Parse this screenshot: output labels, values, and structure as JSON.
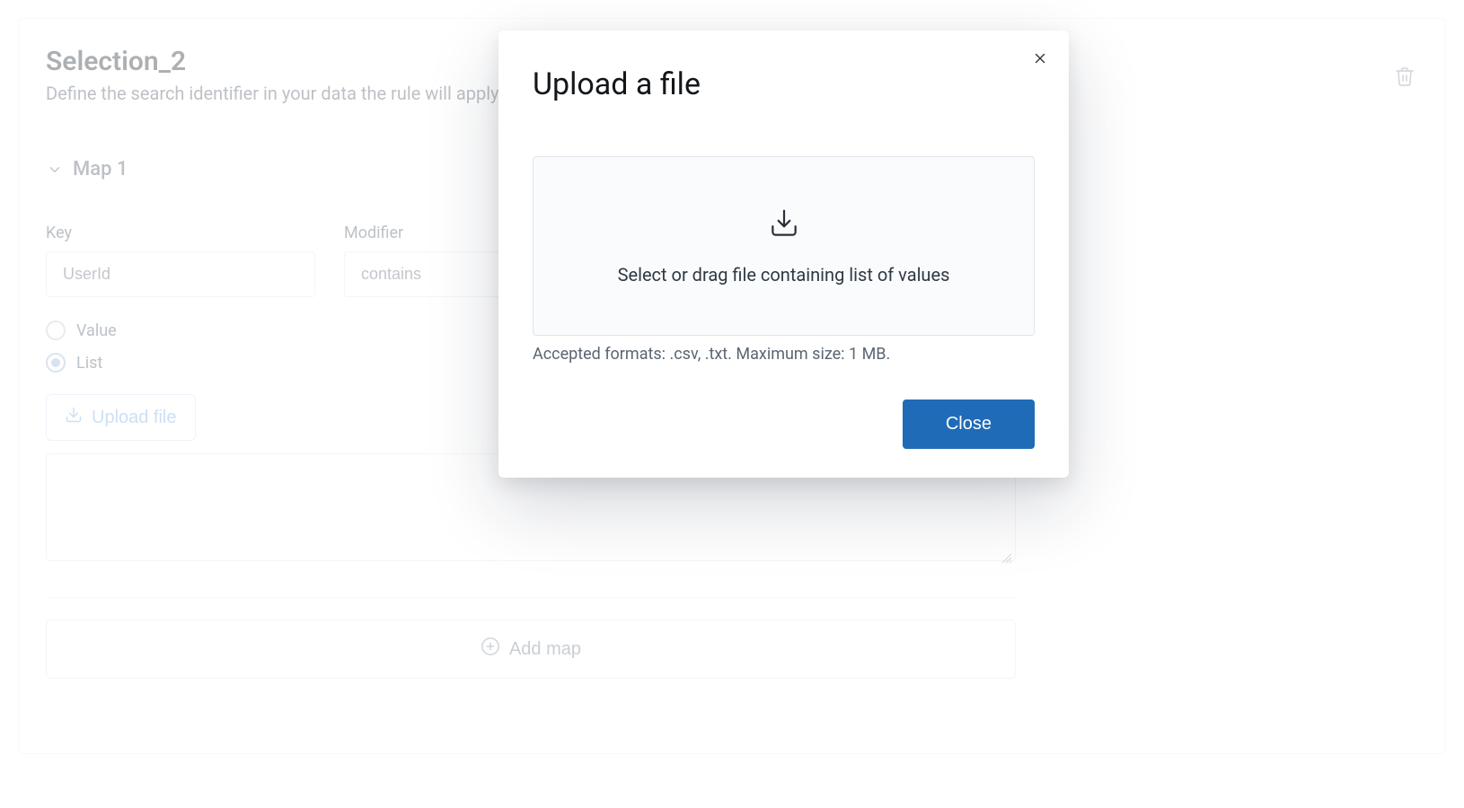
{
  "panel": {
    "title": "Selection_2",
    "subtitle": "Define the search identifier in your data the rule will apply to."
  },
  "map": {
    "header": "Map 1",
    "key_label": "Key",
    "key_value": "UserId",
    "modifier_label": "Modifier",
    "modifier_value": "contains",
    "radio_value": "Value",
    "radio_list": "List",
    "upload_button": "Upload file",
    "add_map": "Add map"
  },
  "modal": {
    "title": "Upload a file",
    "dropzone_text": "Select or drag file containing list of values",
    "hint": "Accepted formats: .csv, .txt. Maximum size: 1 MB.",
    "close": "Close"
  }
}
